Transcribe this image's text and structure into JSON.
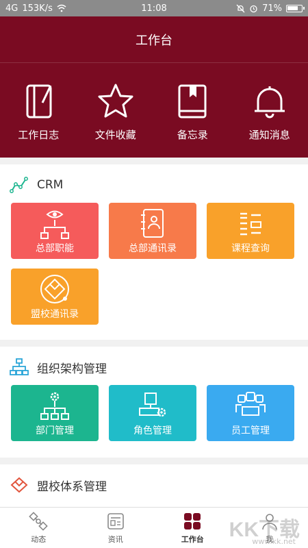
{
  "status_bar": {
    "signal": "4G",
    "speed": "153K/s",
    "time": "11:08",
    "battery": "71%"
  },
  "header": {
    "title": "工作台",
    "quick": [
      {
        "label": "工作日志",
        "icon": "notebook-icon"
      },
      {
        "label": "文件收藏",
        "icon": "star-icon"
      },
      {
        "label": "备忘录",
        "icon": "book-icon"
      },
      {
        "label": "通知消息",
        "icon": "bell-icon"
      }
    ]
  },
  "sections": {
    "crm": {
      "title": "CRM",
      "tiles": [
        {
          "label": "总部职能",
          "color": "#f55b5b",
          "icon": "eye-org-icon"
        },
        {
          "label": "总部通讯录",
          "color": "#f77a4a",
          "icon": "contacts-icon"
        },
        {
          "label": "课程查询",
          "color": "#f9a12a",
          "icon": "list-icon"
        },
        {
          "label": "盟校通讯录",
          "color": "#f9a12a",
          "icon": "diamond-icon"
        }
      ]
    },
    "org": {
      "title": "组织架构管理",
      "tiles": [
        {
          "label": "部门管理",
          "color": "#1cb58f",
          "icon": "org-gear-icon"
        },
        {
          "label": "角色管理",
          "color": "#20bcc9",
          "icon": "role-gear-icon"
        },
        {
          "label": "员工管理",
          "color": "#3aaaf0",
          "icon": "staff-icon"
        }
      ]
    },
    "league": {
      "title": "盟校体系管理"
    }
  },
  "bottom_nav": [
    {
      "label": "动态",
      "icon": "satellite-icon"
    },
    {
      "label": "资讯",
      "icon": "news-icon"
    },
    {
      "label": "工作台",
      "icon": "grid-icon"
    },
    {
      "label": "我",
      "icon": "person-icon"
    }
  ],
  "watermark": {
    "text": "KK下载",
    "url": "www.kk.net"
  }
}
